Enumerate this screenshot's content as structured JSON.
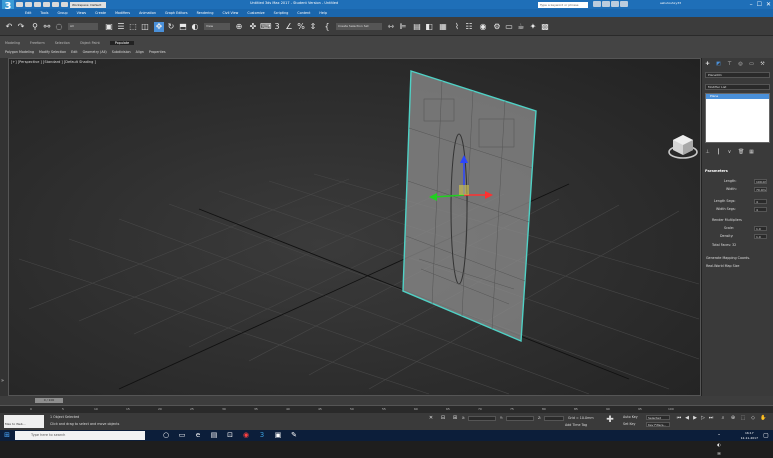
{
  "titlebar": {
    "app_icon": "3",
    "workspace": "Workspace: Default",
    "title": "Untitled 3ds Max 2017 - Student Version - Untitled",
    "search_placeholder": "Type a keyword or phrase",
    "user": "ashutoshxy33",
    "window_buttons": [
      "–",
      "☐",
      "✕"
    ]
  },
  "menu": [
    "Edit",
    "Tools",
    "Group",
    "Views",
    "Create",
    "Modifiers",
    "Animation",
    "Graph Editors",
    "Rendering",
    "Civil View",
    "Customize",
    "Scripting",
    "Content",
    "Help"
  ],
  "toolbar": {
    "filter": "All",
    "view": "View",
    "selection_set": "Create Selection Set"
  },
  "ribbon": {
    "tabs": [
      "Modeling",
      "Freeform",
      "Selection",
      "Object Paint",
      "Populate"
    ],
    "subtools": [
      "Polygon Modeling",
      "Modify Selection",
      "Edit",
      "Geometry (All)",
      "Subdivision",
      "Align",
      "Properties"
    ]
  },
  "viewport": {
    "label": "[+] [Perspective ] [Standard ] [Default Shading ]"
  },
  "command_panel": {
    "name": "Plane001",
    "modifier_list": "Modifier List",
    "stack_item": "Plane",
    "rollout": "Parameters",
    "params": [
      {
        "label": "Length:",
        "value": "109.0mm"
      },
      {
        "label": "Width:",
        "value": "70.0mm"
      },
      {
        "label": "Length Segs:",
        "value": "4"
      },
      {
        "label": "Width Segs:",
        "value": "4"
      }
    ],
    "render_multipliers": "Render Multipliers",
    "multipliers": [
      {
        "label": "Scale:",
        "value": "1.0"
      },
      {
        "label": "Density:",
        "value": "1.0"
      }
    ],
    "total_faces": "Total Faces: 32",
    "options": [
      "Generate Mapping Coords.",
      "Real-World Map Size"
    ]
  },
  "timeline": {
    "frame": "0 / 100",
    "ticks": [
      "0",
      "5",
      "10",
      "15",
      "20",
      "25",
      "30",
      "35",
      "40",
      "45",
      "50",
      "55",
      "60",
      "65",
      "70",
      "75",
      "80",
      "85",
      "90",
      "95",
      "100"
    ]
  },
  "status": {
    "selected": "1 Object Selected",
    "prompt": "Click and drag to select and move objects",
    "script_label": "Max to Web...",
    "x_label": "X:",
    "y_label": "Y:",
    "z_label": "Z:",
    "grid": "Grid = 10.0mm",
    "add_time_tag": "Add Time Tag",
    "auto_key": "Auto Key",
    "set_key": "Set Key",
    "selected_mode": "Selected",
    "key_filters": "Key Filters..."
  },
  "taskbar": {
    "search_placeholder": "Type here to search",
    "time": "16:17",
    "date": "12-11-2017"
  },
  "colors": {
    "accent": "#1f6fb8",
    "selection_outline": "#4fd1c5"
  }
}
